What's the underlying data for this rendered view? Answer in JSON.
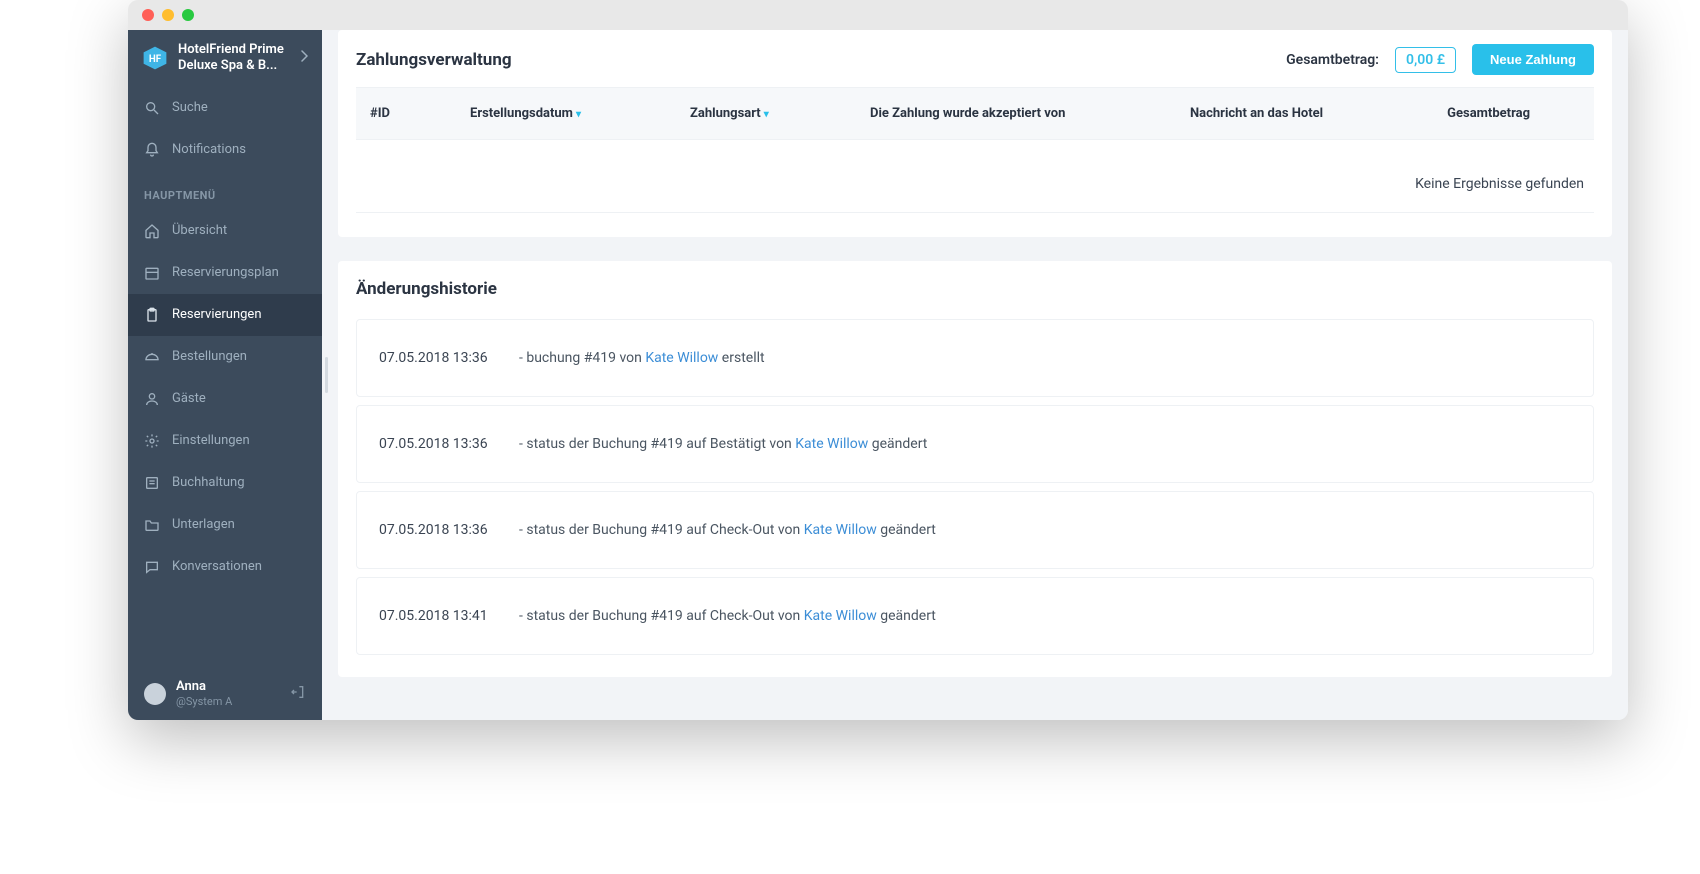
{
  "sidebar": {
    "hotel_name": "HotelFriend Prime Deluxe Spa & B...",
    "search": "Suche",
    "notifications": "Notifications",
    "section": "HAUPTMENÜ",
    "items": [
      {
        "label": "Übersicht"
      },
      {
        "label": "Reservierungsplan"
      },
      {
        "label": "Reservierungen"
      },
      {
        "label": "Bestellungen"
      },
      {
        "label": "Gäste"
      },
      {
        "label": "Einstellungen"
      },
      {
        "label": "Buchhaltung"
      },
      {
        "label": "Unterlagen"
      },
      {
        "label": "Konversationen"
      }
    ],
    "user_name": "Anna",
    "user_sub": "@System A"
  },
  "payments": {
    "title": "Zahlungsverwaltung",
    "total_label": "Gesamtbetrag:",
    "total_value": "0,00 £",
    "new_button": "Neue Zahlung",
    "cols": {
      "id": "#ID",
      "date": "Erstellungsdatum",
      "type": "Zahlungsart",
      "accept": "Die Zahlung wurde akzeptiert von",
      "msg": "Nachricht an das Hotel",
      "total": "Gesamtbetrag"
    },
    "no_results": "Keine Ergebnisse gefunden"
  },
  "history": {
    "title": "Änderungshistorie",
    "items": [
      {
        "ts": "07.05.2018 13:36",
        "pre": "- buchung #419 von ",
        "user": "Kate Willow",
        "post": " erstellt"
      },
      {
        "ts": "07.05.2018 13:36",
        "pre": "- status der Buchung #419 auf Bestätigt von ",
        "user": "Kate Willow",
        "post": " geändert"
      },
      {
        "ts": "07.05.2018 13:36",
        "pre": "- status der Buchung #419 auf Check-Out von ",
        "user": "Kate Willow",
        "post": " geändert"
      },
      {
        "ts": "07.05.2018 13:41",
        "pre": "- status der Buchung #419 auf Check-Out von ",
        "user": "Kate Willow",
        "post": " geändert"
      }
    ]
  }
}
